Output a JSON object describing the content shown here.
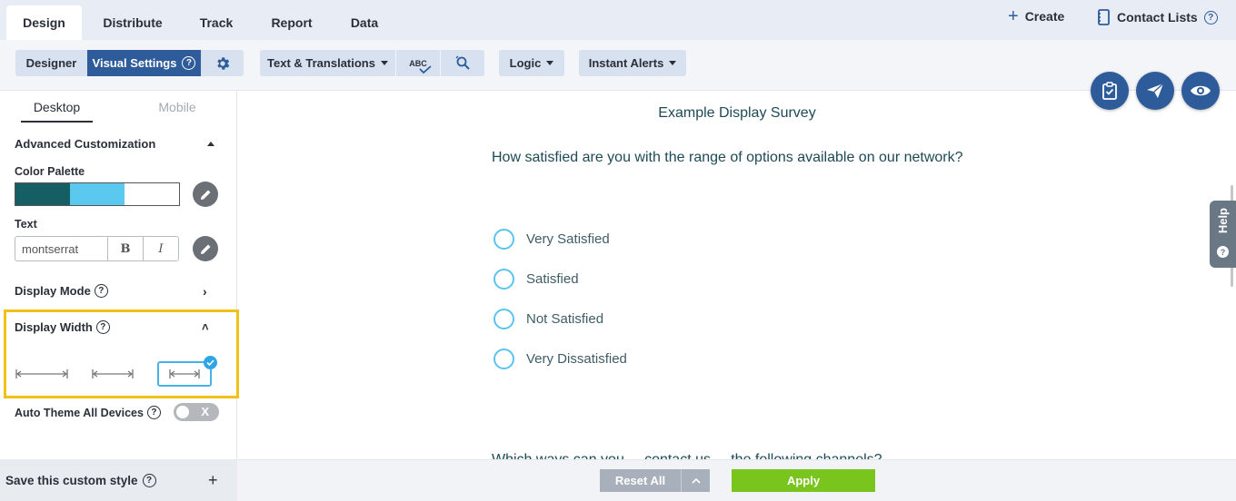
{
  "nav": {
    "tabs": [
      "Design",
      "Distribute",
      "Track",
      "Report",
      "Data"
    ],
    "create": "Create",
    "contact_lists": "Contact Lists"
  },
  "toolbar": {
    "designer": "Designer",
    "visual_settings": "Visual Settings",
    "text_translations": "Text & Translations",
    "spell_check": "ABC",
    "logic": "Logic",
    "instant_alerts": "Instant Alerts"
  },
  "left_panel": {
    "tabs": {
      "desktop": "Desktop",
      "mobile": "Mobile"
    },
    "advanced_customization": "Advanced Customization",
    "color_palette": {
      "label": "Color Palette",
      "colors": [
        "#155e63",
        "#5bc8f0",
        "#ffffff"
      ]
    },
    "text": {
      "label": "Text",
      "font": "montserrat",
      "bold": "B",
      "italic": "I"
    },
    "display_mode": "Display Mode",
    "display_width": {
      "label": "Display Width",
      "selected": "full-width"
    },
    "auto_theme": "Auto Theme All Devices",
    "auto_theme_toggle": "X"
  },
  "bottom": {
    "save_style": "Save this custom style",
    "plus": "+",
    "reset_all": "Reset All",
    "apply": "Apply"
  },
  "survey": {
    "title": "Example Display Survey",
    "question1": "How satisfied are you with the range of options available on our network?",
    "options": [
      "Very Satisfied",
      "Satisfied",
      "Not Satisfied",
      "Very Dissatisfied"
    ],
    "question2": "Which ways can you ... contact us ... the following channels?"
  },
  "help_tab": "Help",
  "colors": {
    "nav_bg": "#e8ecf4",
    "primary": "#2e5c9a",
    "apply": "#79c51e",
    "highlight": "#f2c01a",
    "radio": "#5cc4ec"
  }
}
